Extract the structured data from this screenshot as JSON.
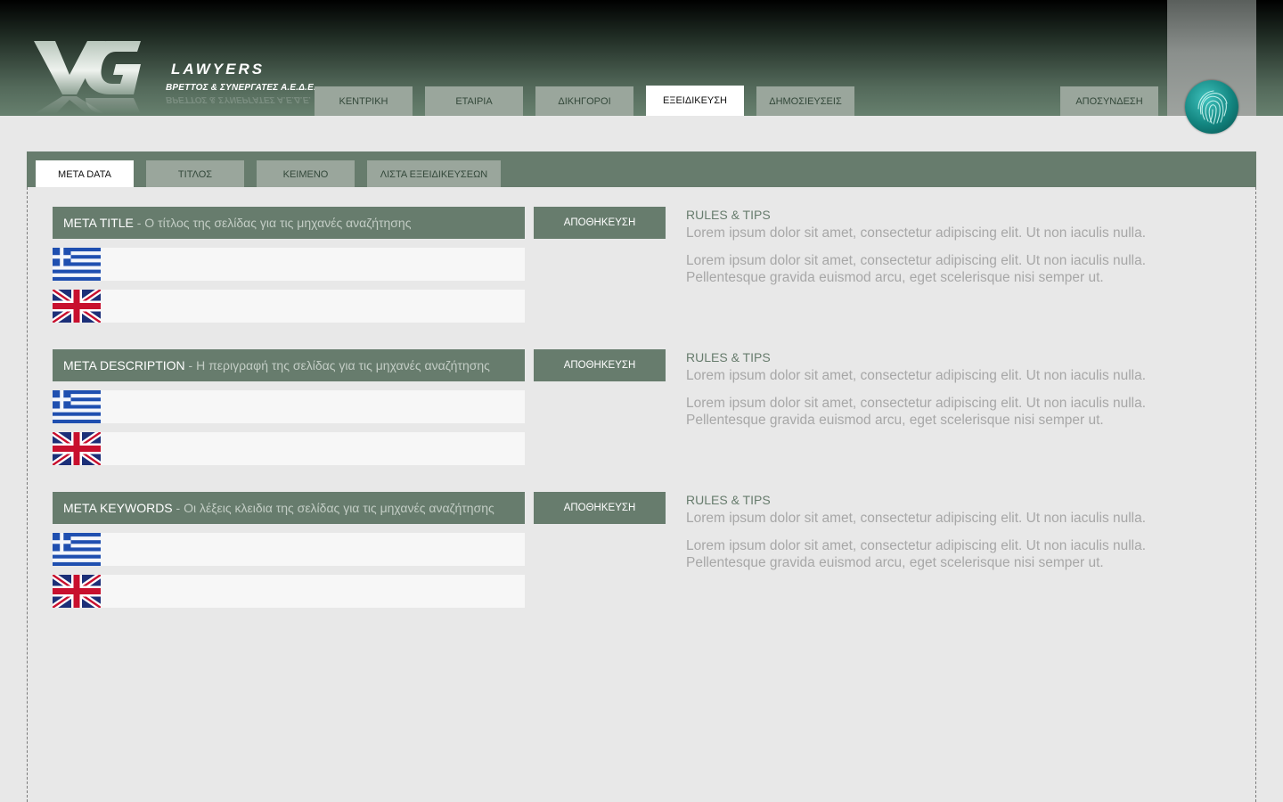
{
  "logo": {
    "brand": "LAWYERS",
    "subtitle": "ΒΡΕΤΤΟΣ & ΣΥΝΕΡΓΑΤΕΣ Α.Ε.Δ.Ε."
  },
  "nav": {
    "tabs": [
      {
        "label": "ΚΕΝΤΡΙΚΗ",
        "active": false
      },
      {
        "label": "ΕΤΑΙΡΙΑ",
        "active": false
      },
      {
        "label": "ΔΙΚΗΓΟΡΟΙ",
        "active": false
      },
      {
        "label": "ΕΞΕΙΔΙΚΕΥΣΗ",
        "active": true
      },
      {
        "label": "ΔΗΜΟΣΙΕΥΣΕΙΣ",
        "active": false
      }
    ],
    "logout": "ΑΠΟΣΥΝΔΕΣΗ"
  },
  "subtabs": [
    {
      "label": "META DATA",
      "active": true
    },
    {
      "label": "ΤΙΤΛΟΣ",
      "active": false
    },
    {
      "label": "ΚΕΙΜΕΝΟ",
      "active": false
    },
    {
      "label": "ΛΙΣΤΑ ΕΞΕΙΔΙΚΕΥΣΕΩΝ",
      "active": false
    }
  ],
  "sections": [
    {
      "label": "META TITLE",
      "hint": " - Ο τίτλος της σελίδας για τις μηχανές αναζήτησης",
      "save": "ΑΠΟΘΗΚΕΥΣΗ",
      "greek_value": "",
      "english_value": "",
      "tips_title": "RULES & TIPS",
      "tips": [
        "Lorem ipsum dolor sit amet, consectetur adipiscing elit. Ut non iaculis nulla.",
        "Lorem ipsum dolor sit amet, consectetur adipiscing elit. Ut non iaculis nulla. Pellentesque gravida euismod arcu, eget scelerisque nisi semper ut."
      ]
    },
    {
      "label": "META DESCRIPTION",
      "hint": " - Η περιγραφή της σελίδας για τις μηχανές αναζήτησης",
      "save": "ΑΠΟΘΗΚΕΥΣΗ",
      "greek_value": "",
      "english_value": "",
      "tips_title": "RULES & TIPS",
      "tips": [
        "Lorem ipsum dolor sit amet, consectetur adipiscing elit. Ut non iaculis nulla.",
        "Lorem ipsum dolor sit amet, consectetur adipiscing elit. Ut non iaculis nulla. Pellentesque gravida euismod arcu, eget scelerisque nisi semper ut."
      ]
    },
    {
      "label": "META KEYWORDS",
      "hint": " - Οι λέξεις κλειδια της σελίδας για τις μηχανές αναζήτησης",
      "save": "ΑΠΟΘΗΚΕΥΣΗ",
      "greek_value": "",
      "english_value": "",
      "tips_title": "RULES & TIPS",
      "tips": [
        "Lorem ipsum dolor sit amet, consectetur adipiscing elit. Ut non iaculis nulla.",
        "Lorem ipsum dolor sit amet, consectetur adipiscing elit. Ut non iaculis nulla. Pellentesque gravida euismod arcu, eget scelerisque nisi semper ut."
      ]
    }
  ],
  "icons": {
    "greek_flag": "greek-flag-icon",
    "uk_flag": "uk-flag-icon",
    "user": "fingerprint-icon"
  },
  "colors": {
    "accent": "#677c6d",
    "tab_inactive": "#9aa69c",
    "tab_active": "#ffffff",
    "background": "#e8e8e8",
    "input_bg": "#f7f7f7",
    "tips_text": "#a7a7a7"
  }
}
